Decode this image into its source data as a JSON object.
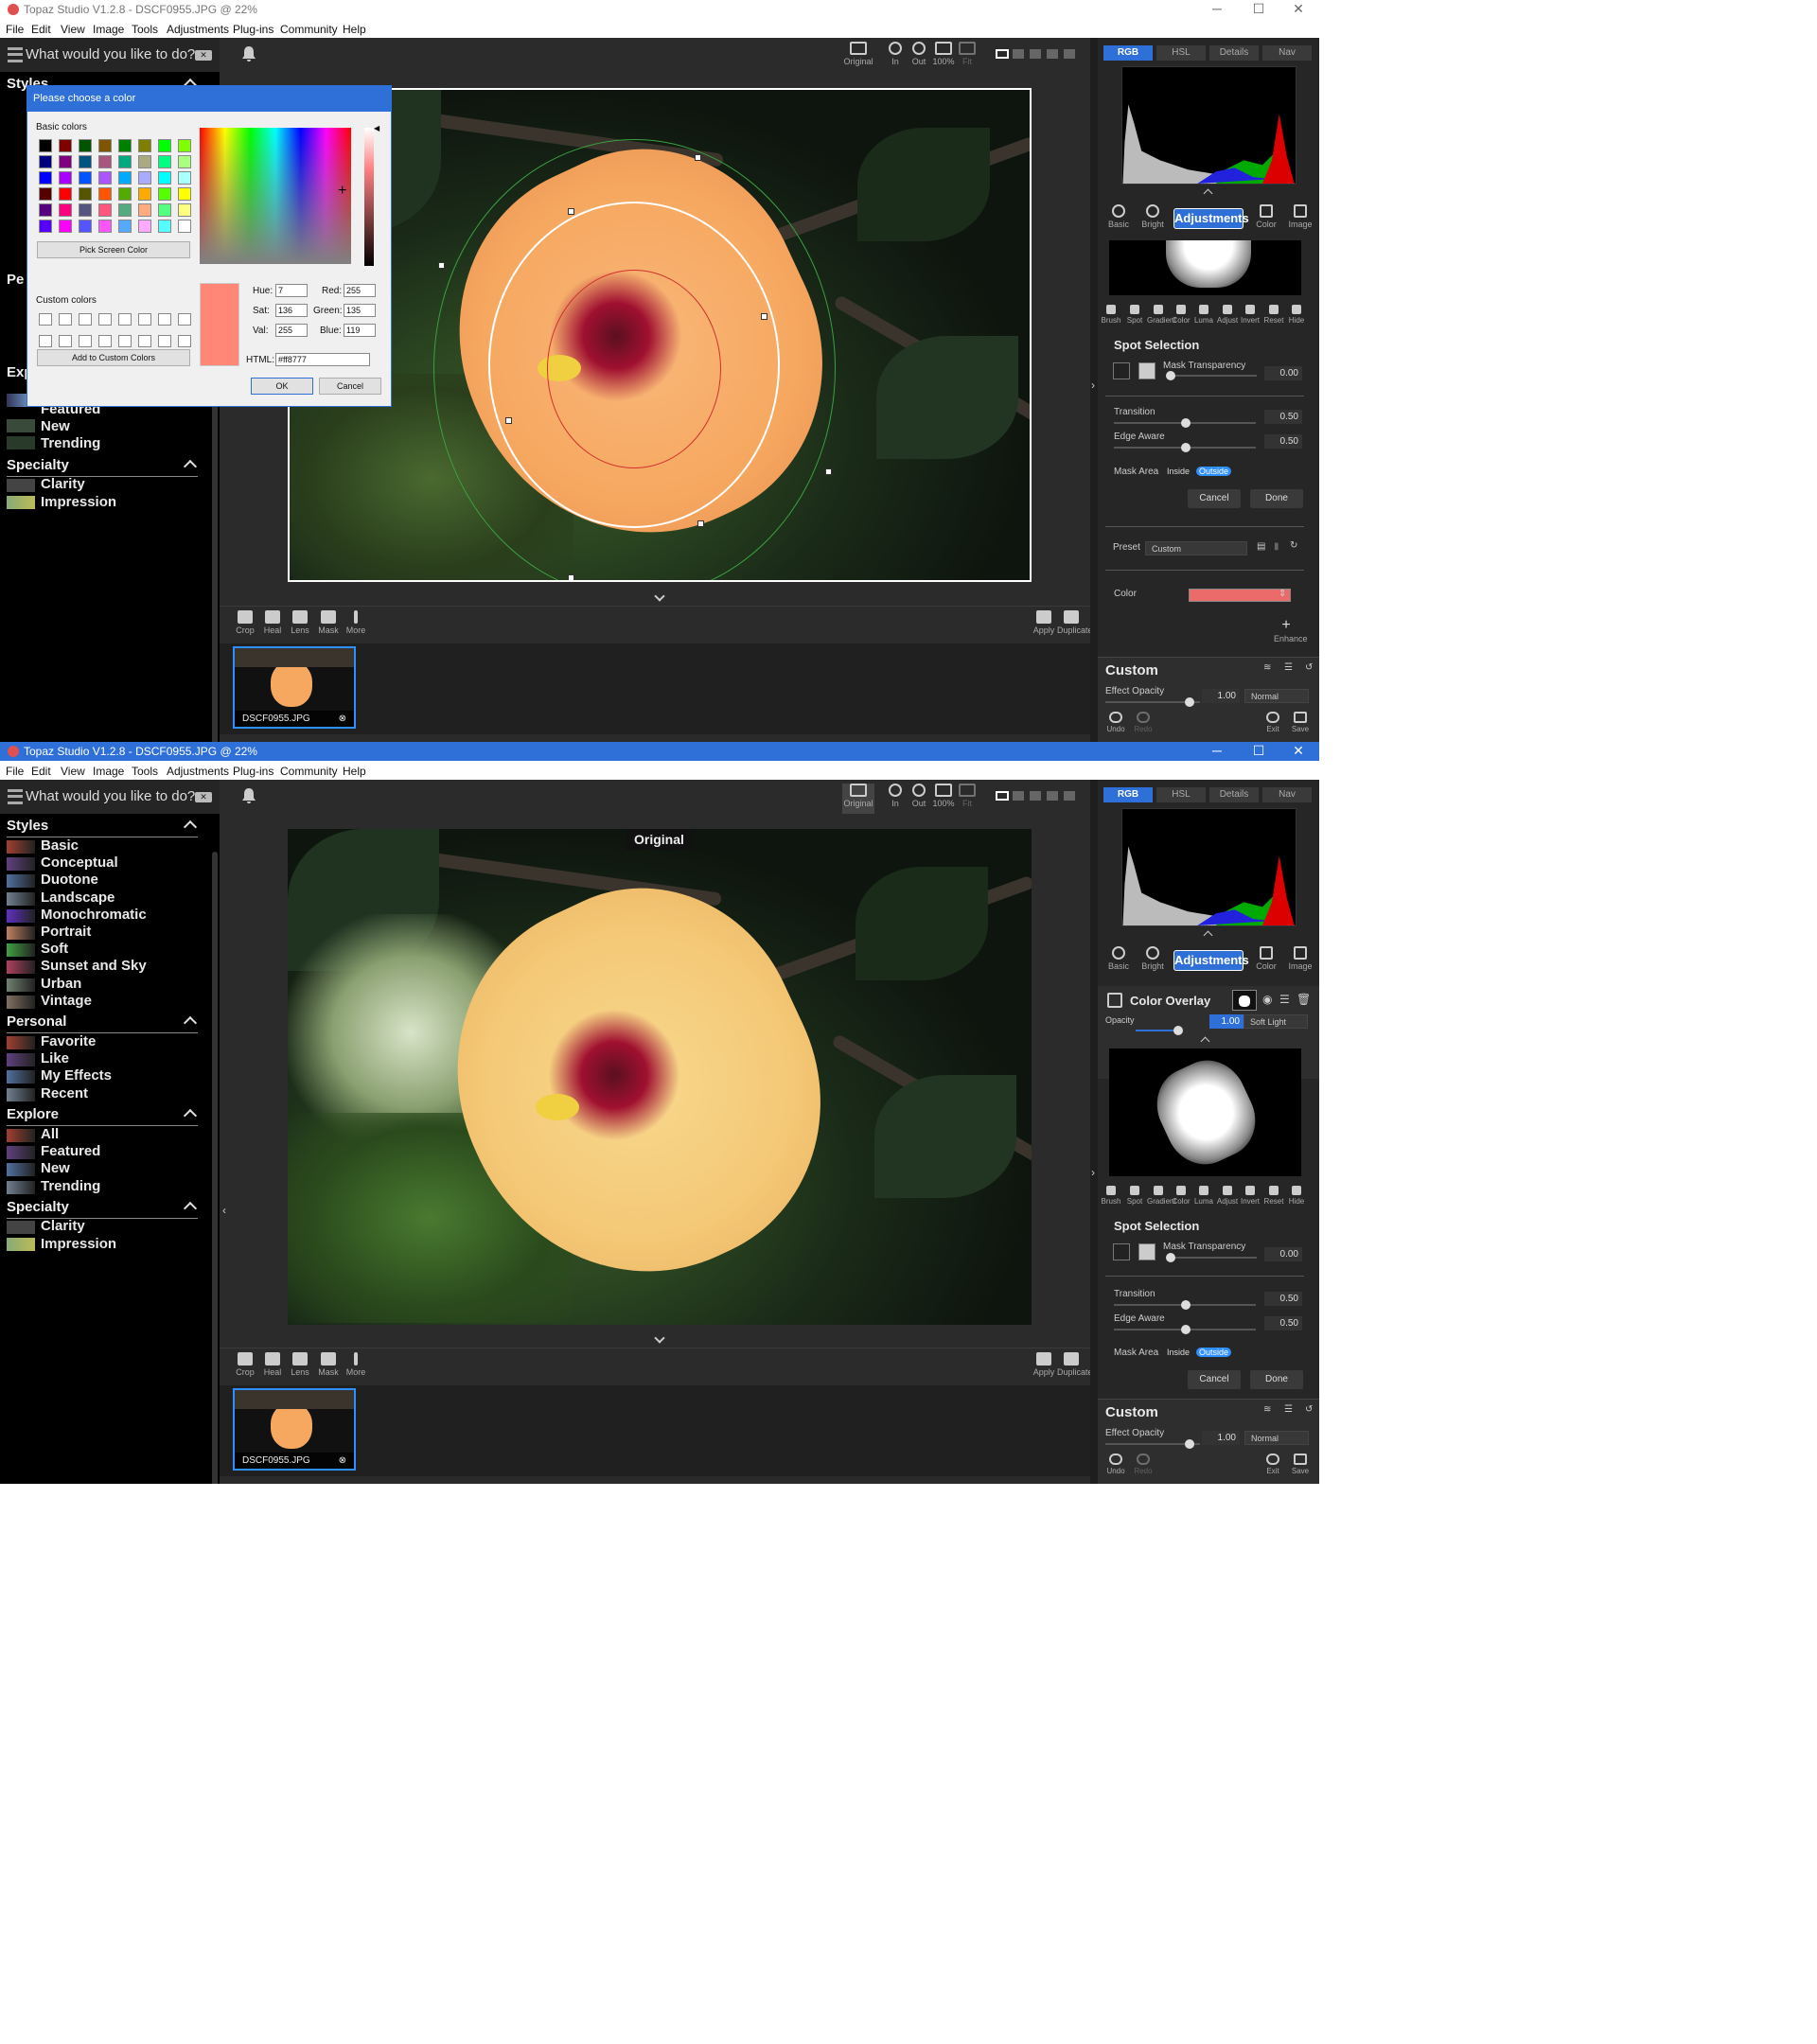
{
  "window": {
    "title": "Topaz Studio V1.2.8 - DSCF0955.JPG @ 22%"
  },
  "menu": [
    "File",
    "Edit",
    "View",
    "Image",
    "Tools",
    "Adjustments",
    "Plug-ins",
    "Community",
    "Help"
  ],
  "search": {
    "placeholder": "What would you like to do?"
  },
  "styles": {
    "header": "Styles",
    "items": [
      "Basic",
      "Conceptual",
      "Duotone",
      "Landscape",
      "Monochromatic",
      "Portrait",
      "Soft",
      "Sunset and Sky",
      "Urban",
      "Vintage"
    ]
  },
  "personal": {
    "header": "Personal",
    "items": [
      "Favorite",
      "Like",
      "My Effects",
      "Recent"
    ]
  },
  "explore": {
    "header": "Explore",
    "items": [
      "All",
      "Featured",
      "New",
      "Trending"
    ]
  },
  "specialty": {
    "header": "Specialty",
    "items": [
      "Clarity",
      "Impression"
    ]
  },
  "view_toolbar": {
    "original": "Original",
    "in": "In",
    "out": "Out",
    "zoom100": "100%",
    "fit": "Fit"
  },
  "photo_tools": [
    "Crop",
    "Heal",
    "Lens",
    "Mask",
    "More"
  ],
  "apply_tools": {
    "apply": "Apply",
    "duplicate": "Duplicate"
  },
  "filmstrip": {
    "filename": "DSCF0955.JPG"
  },
  "original_tag": "Original",
  "right": {
    "tabs": [
      "RGB",
      "HSL",
      "Details",
      "Nav"
    ],
    "adj_tabs": [
      "Basic",
      "Bright",
      "Color",
      "Image"
    ],
    "adjustments_label": "Adjustments",
    "mask_tools": [
      "Brush",
      "Spot",
      "Gradient",
      "Color",
      "Luma",
      "Adjust",
      "Invert",
      "Reset",
      "Hide"
    ],
    "spot_selection": "Spot Selection",
    "mask_transparency": {
      "label": "Mask Transparency",
      "value": "0.00"
    },
    "transition": {
      "label": "Transition",
      "value": "0.50"
    },
    "edge_aware": {
      "label": "Edge Aware",
      "value": "0.50"
    },
    "mask_area": {
      "label": "Mask Area",
      "inside": "Inside",
      "outside": "Outside"
    },
    "cancel": "Cancel",
    "done": "Done",
    "preset": {
      "label": "Preset",
      "value": "Custom"
    },
    "color": {
      "label": "Color",
      "swatch": "#eb6b6b"
    },
    "enhance": "Enhance",
    "custom_title": "Custom",
    "effect_opacity": {
      "label": "Effect Opacity",
      "value": "1.00",
      "blend": "Normal"
    },
    "footer": {
      "undo": "Undo",
      "redo": "Redo",
      "exit": "Exit",
      "save": "Save"
    },
    "color_overlay": {
      "title": "Color Overlay",
      "opacity_label": "Opacity",
      "opacity": "1.00",
      "blend": "Soft Light"
    }
  },
  "dialog": {
    "title": "Please choose a color",
    "basic_colors": "Basic colors",
    "pick_screen": "Pick Screen Color",
    "custom_colors": "Custom colors",
    "add_custom": "Add to Custom Colors",
    "hue_label": "Hue:",
    "hue": "7",
    "sat_label": "Sat:",
    "sat": "136",
    "val_label": "Val:",
    "val": "255",
    "red_label": "Red:",
    "red": "255",
    "green_label": "Green:",
    "green": "135",
    "blue_label": "Blue:",
    "blue": "119",
    "html_label": "HTML:",
    "html": "#ff8777",
    "ok": "OK",
    "cancel": "Cancel",
    "swatches": [
      "#000000",
      "#800000",
      "#005500",
      "#805500",
      "#008000",
      "#808000",
      "#00ff00",
      "#80ff00",
      "#00007f",
      "#800080",
      "#005580",
      "#aa5580",
      "#00aa80",
      "#aaaa80",
      "#00ff80",
      "#aaff80",
      "#0000ff",
      "#aa00ff",
      "#0055ff",
      "#aa55ff",
      "#00aaff",
      "#aaaaff",
      "#00ffff",
      "#aaffff",
      "#550000",
      "#ff0000",
      "#555500",
      "#ff5500",
      "#55aa00",
      "#ffaa00",
      "#55ff00",
      "#ffff00",
      "#55007f",
      "#ff007f",
      "#55557f",
      "#ff557f",
      "#55aa7f",
      "#ffaa7f",
      "#55ff7f",
      "#ffff7f",
      "#5500ff",
      "#ff00ff",
      "#5555ff",
      "#ff55ff",
      "#55aaff",
      "#ffaaff",
      "#55ffff",
      "#ffffff"
    ]
  }
}
